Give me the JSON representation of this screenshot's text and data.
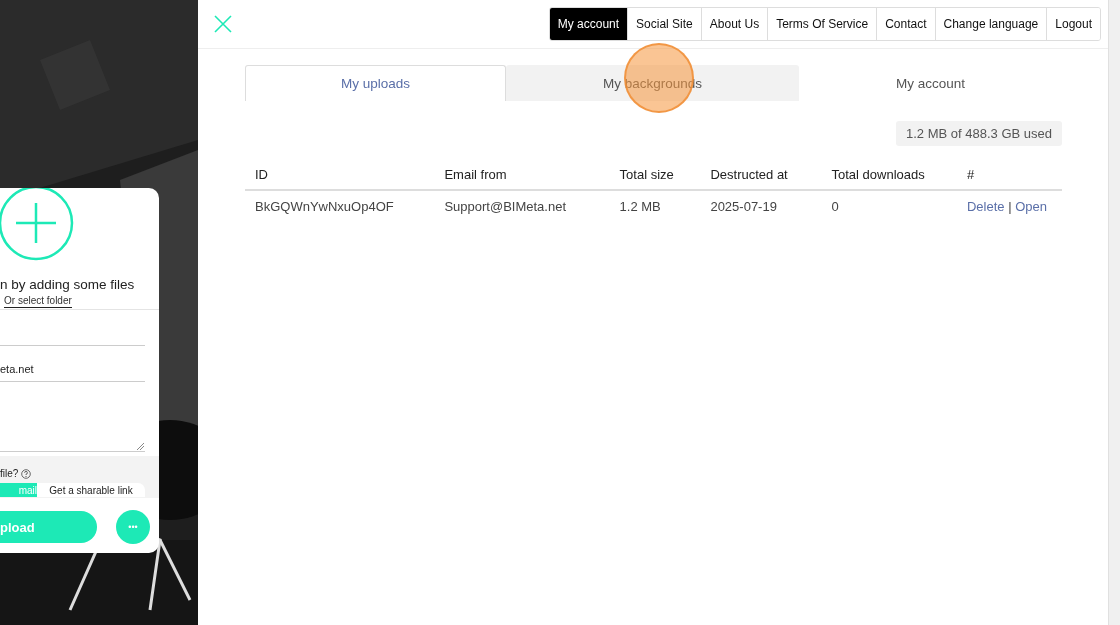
{
  "upload_card": {
    "drop_hint": "n by adding some files",
    "folder_link": "Or select folder",
    "email_value": "eta.net",
    "share_question": "file?",
    "share_options": [
      {
        "label": "mail",
        "selected": true
      },
      {
        "label": "Get a sharable link",
        "selected": false
      }
    ],
    "upload_button": "pload",
    "more_button": "•••"
  },
  "nav": [
    {
      "label": "My account",
      "selected": true
    },
    {
      "label": "Social Site",
      "selected": false
    },
    {
      "label": "About Us",
      "selected": false
    },
    {
      "label": "Terms Of Service",
      "selected": false
    },
    {
      "label": "Contact",
      "selected": false
    },
    {
      "label": "Change language",
      "selected": false
    },
    {
      "label": "Logout",
      "selected": false
    }
  ],
  "tabs": [
    {
      "label": "My uploads",
      "selected": true
    },
    {
      "label": "My backgrounds",
      "selected": false
    },
    {
      "label": "My account",
      "selected": false
    }
  ],
  "usage": "1.2 MB of 488.3 GB used",
  "table": {
    "columns": [
      "ID",
      "Email from",
      "Total size",
      "Destructed at",
      "Total downloads",
      "#"
    ],
    "rows": [
      {
        "id": "BkGQWnYwNxuOp4OF",
        "email_from": "Support@BIMeta.net",
        "total_size": "1.2 MB",
        "destructed_at": "2025-07-19",
        "total_downloads": "0",
        "actions": [
          "Delete",
          "Open"
        ]
      }
    ]
  },
  "action_separator": "|"
}
